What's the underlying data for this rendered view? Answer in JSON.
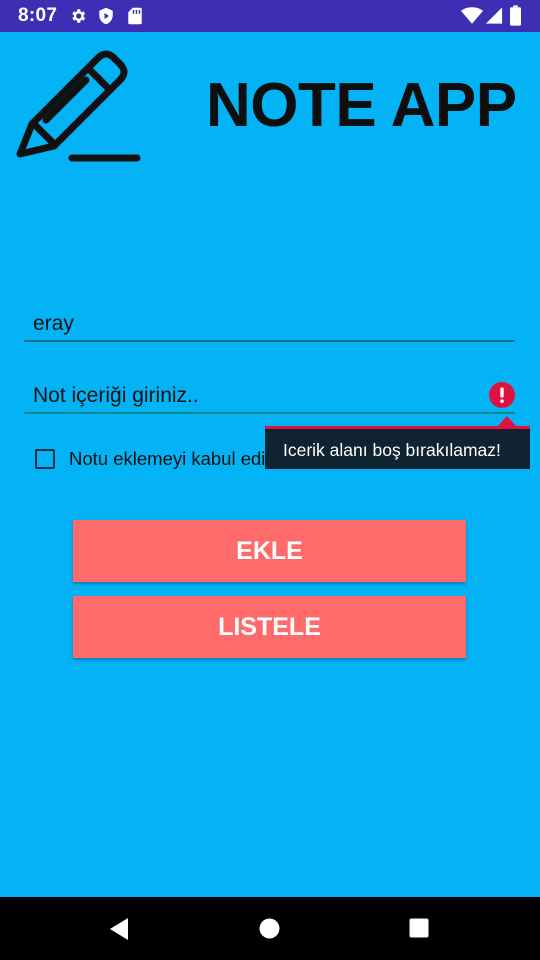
{
  "status_bar": {
    "time": "8:07",
    "icons_left": [
      "settings-icon",
      "play-protect-icon",
      "sd-card-icon"
    ],
    "icons_right": [
      "wifi-icon",
      "signal-icon",
      "battery-icon"
    ],
    "background": "#3F2DB3"
  },
  "app": {
    "title": "NOTE APP",
    "logo_icon": "pencil-edit-icon",
    "background": "#03B3F5",
    "title_field": {
      "value": "eray"
    },
    "content_field": {
      "placeholder": "Not içeriği giriniz..",
      "has_error": true,
      "error_icon": "alert-circle-icon"
    },
    "error_message": "Icerik alanı boş bırakılamaz!",
    "consent": {
      "label": "Notu eklemeyi kabul ediyor musunuz?",
      "checked": false
    },
    "buttons": {
      "add": "EKLE",
      "list": "LISTELE"
    },
    "button_color": "#FF6B6B",
    "error_color": "#E0103F"
  },
  "nav_bar": {
    "icons": [
      "back-icon",
      "home-icon",
      "recents-icon"
    ]
  }
}
